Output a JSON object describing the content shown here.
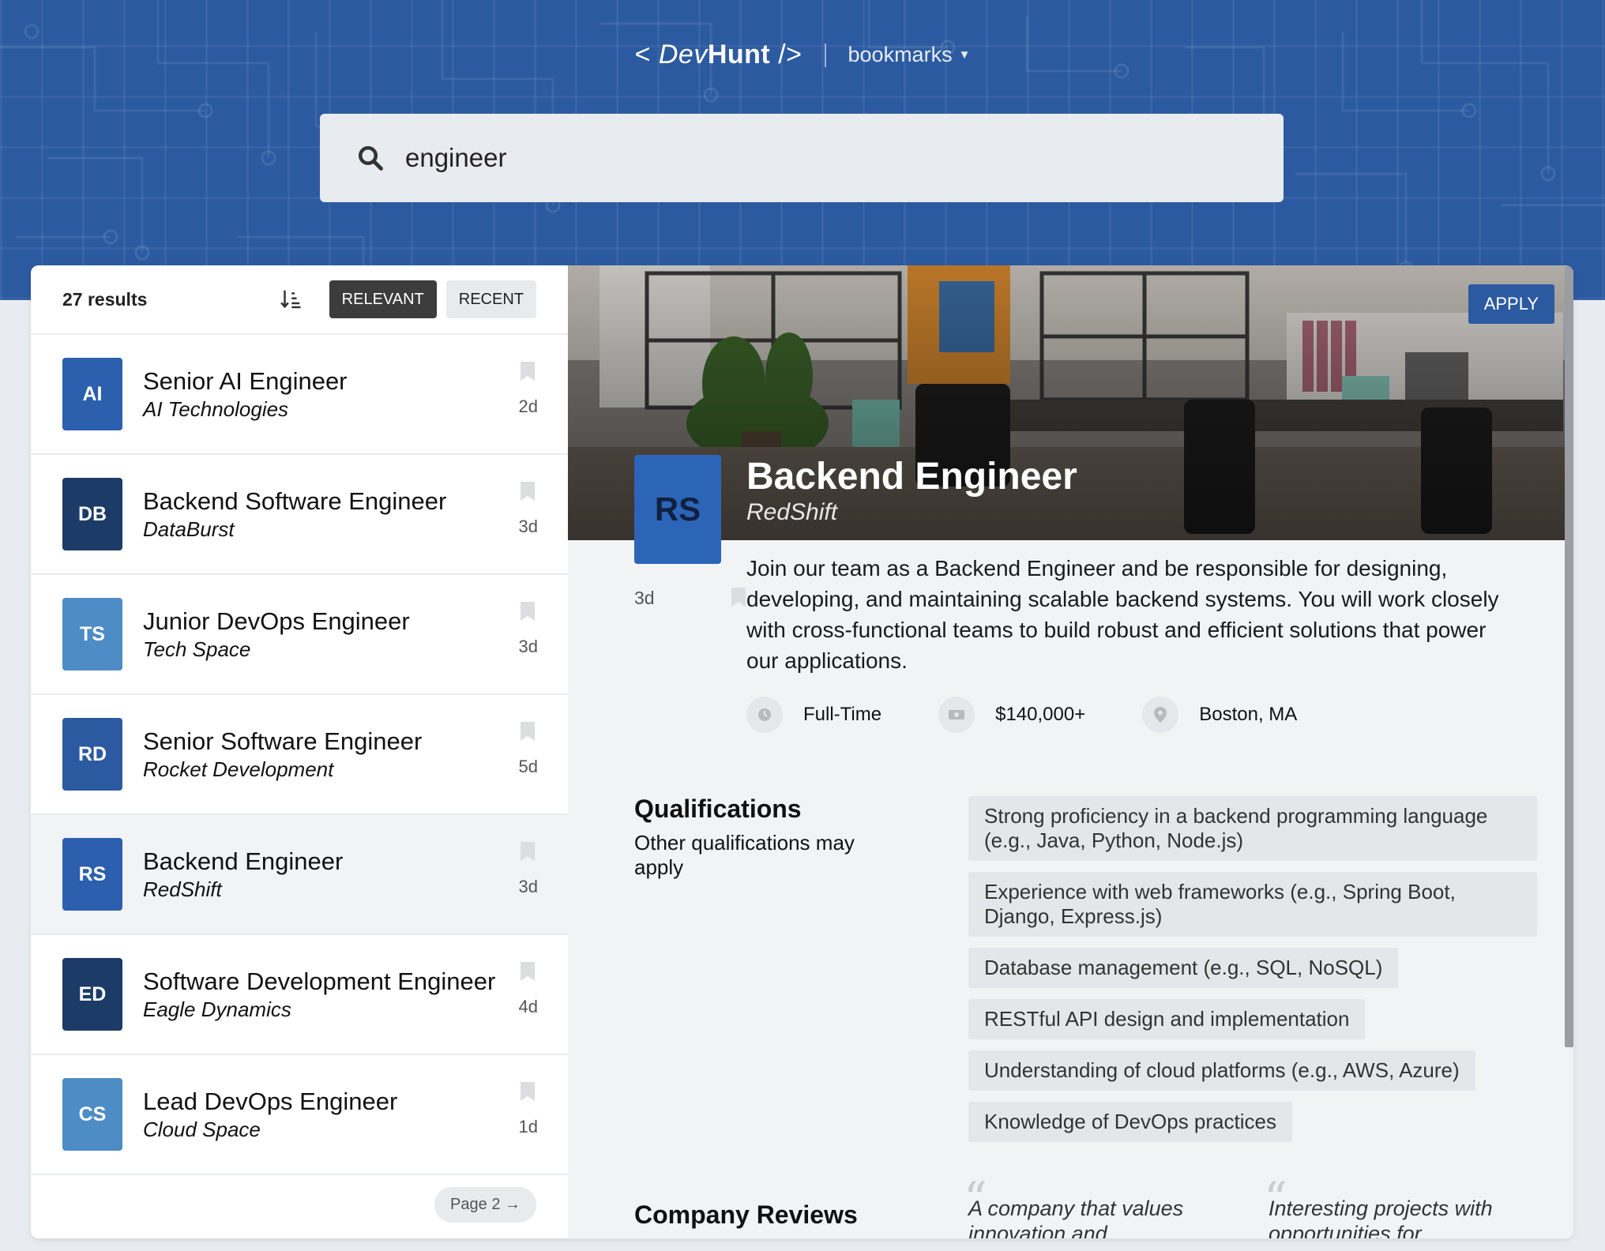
{
  "header": {
    "logo_left": "< ",
    "logo_dev": "Dev",
    "logo_hunt": "Hunt",
    "logo_right": " />",
    "bookmarks_label": "bookmarks"
  },
  "search": {
    "value": "engineer"
  },
  "list": {
    "results_count": "27 results",
    "sort_relevant": "RELEVANT",
    "sort_recent": "RECENT",
    "pager": "Page 2 →",
    "jobs": [
      {
        "initials": "AI",
        "title": "Senior AI Engineer",
        "company": "AI Technologies",
        "age": "2d",
        "color": "#2c5fae"
      },
      {
        "initials": "DB",
        "title": "Backend Software Engineer",
        "company": "DataBurst",
        "age": "3d",
        "color": "#1c3b66"
      },
      {
        "initials": "TS",
        "title": "Junior DevOps Engineer",
        "company": "Tech Space",
        "age": "3d",
        "color": "#4e8cc6"
      },
      {
        "initials": "RD",
        "title": "Senior Software Engineer",
        "company": "Rocket Development",
        "age": "5d",
        "color": "#2c5aa0"
      },
      {
        "initials": "RS",
        "title": "Backend Engineer",
        "company": "RedShift",
        "age": "3d",
        "color": "#2c5fae"
      },
      {
        "initials": "ED",
        "title": "Software Development Engineer",
        "company": "Eagle Dynamics",
        "age": "4d",
        "color": "#1c3b66"
      },
      {
        "initials": "CS",
        "title": "Lead DevOps Engineer",
        "company": "Cloud Space",
        "age": "1d",
        "color": "#4e8cc6"
      }
    ]
  },
  "detail": {
    "apply_label": "APPLY",
    "initials": "RS",
    "title": "Backend Engineer",
    "company": "RedShift",
    "age": "3d",
    "description": "Join our team as a Backend Engineer and be responsible for designing, developing, and maintaining scalable backend systems. You will work closely with cross-functional teams to build robust and efficient solutions that power our applications.",
    "employment_type": "Full-Time",
    "salary": "$140,000+",
    "location": "Boston, MA",
    "qualifications_heading": "Qualifications",
    "qualifications_sub": "Other qualifications may apply",
    "qualifications": [
      "Strong proficiency in a backend programming language (e.g., Java, Python, Node.js)",
      "Experience with web frameworks (e.g., Spring Boot, Django, Express.js)",
      "Database management (e.g., SQL, NoSQL)",
      "RESTful API design and implementation",
      "Understanding of cloud platforms (e.g., AWS, Azure)",
      "Knowledge of DevOps practices"
    ],
    "reviews_heading": "Company Reviews",
    "reviews": [
      "A company that values innovation and",
      "Interesting projects with opportunities for"
    ]
  },
  "colors": {
    "brand": "#2c5aa0",
    "hero": "#2c5aa0",
    "selected_row": "#f2f3f5"
  }
}
